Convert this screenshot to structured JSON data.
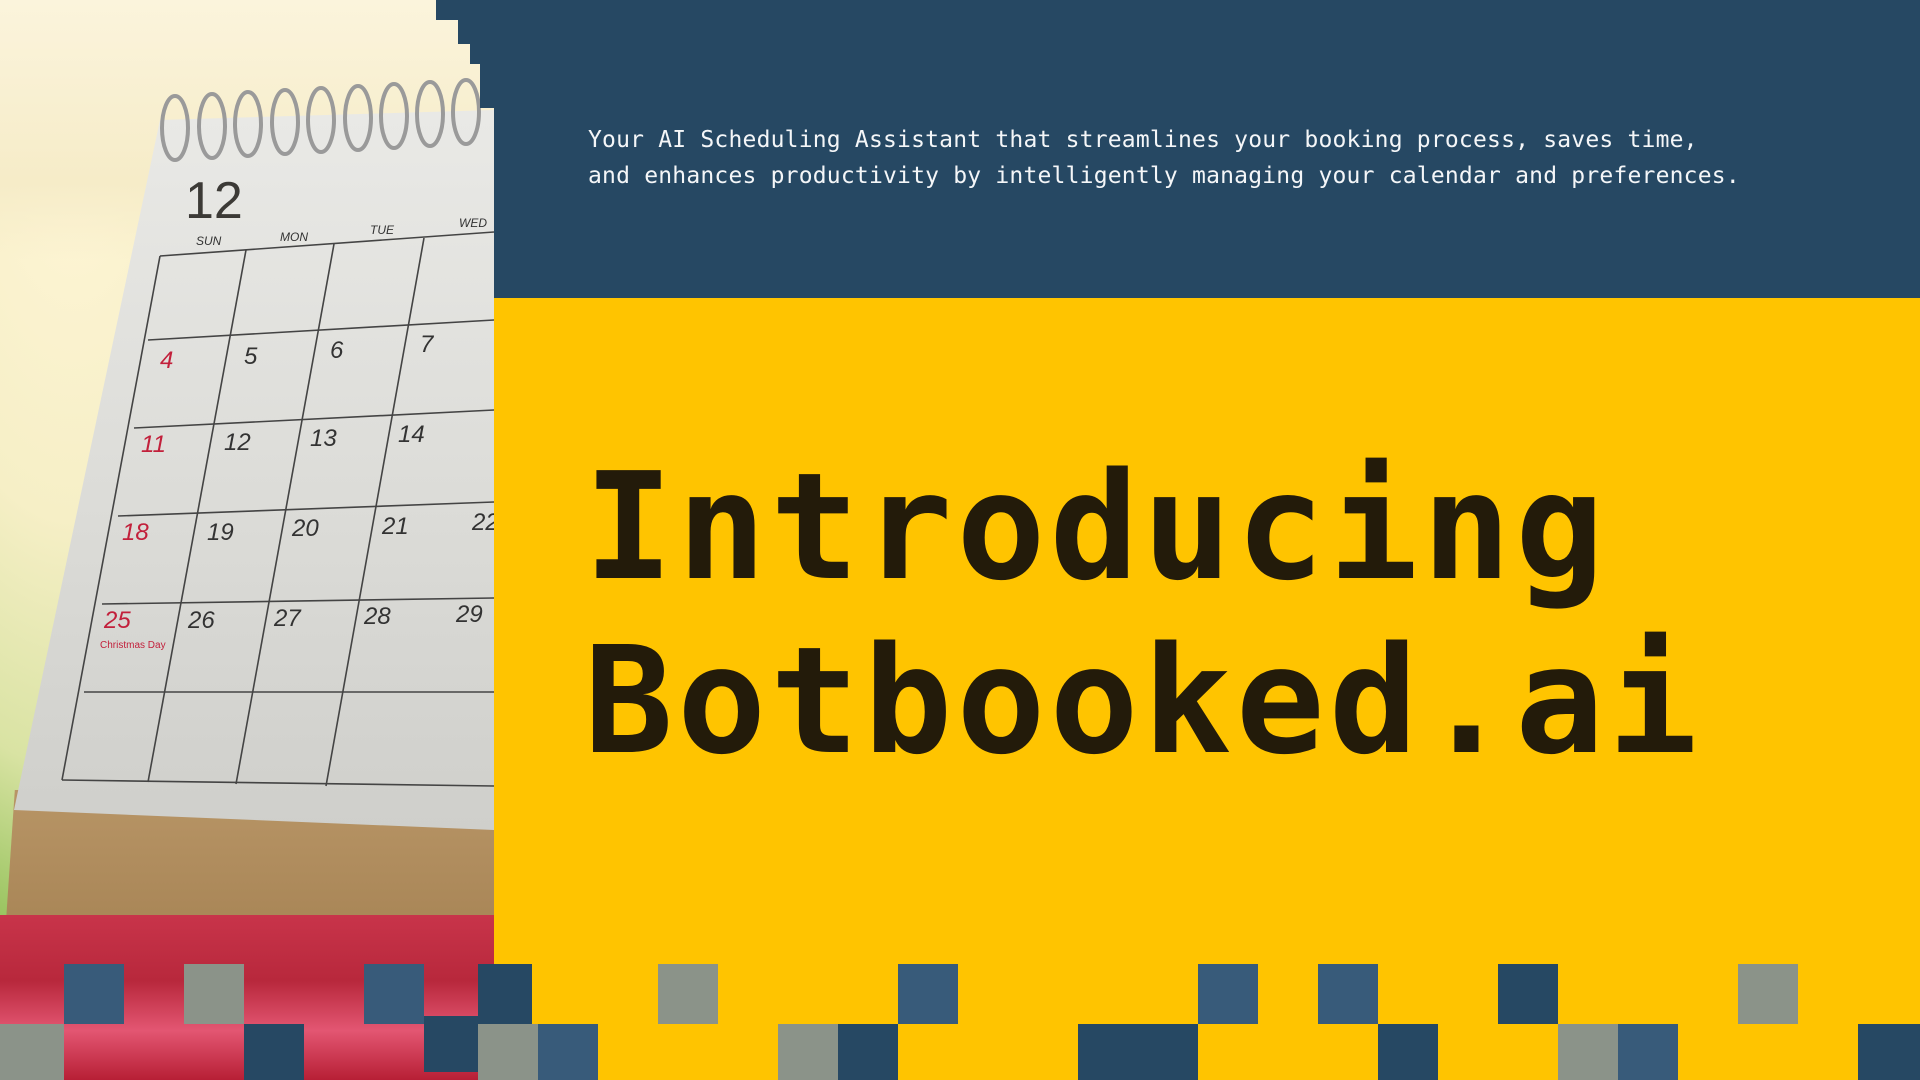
{
  "tagline": "Your AI Scheduling Assistant that streamlines your booking process, saves time, and enhances productivity by intelligently managing your calendar and preferences.",
  "headline": {
    "line1": "Introducing",
    "line2": "Botbooked.ai"
  },
  "photo": {
    "alt": "Desk calendar",
    "calendar": {
      "month": "12",
      "days": [
        "SUN",
        "MON",
        "TUE",
        "WED"
      ],
      "weeks": [
        [
          "4",
          "5",
          "6",
          "7"
        ],
        [
          "11",
          "12",
          "13",
          "14"
        ],
        [
          "18",
          "19",
          "20",
          "21",
          "22"
        ],
        [
          "25",
          "26",
          "27",
          "28",
          "29"
        ]
      ],
      "holiday": "Christmas Day"
    }
  },
  "colors": {
    "background": "#FFC400",
    "navy": "#264863",
    "blue": "#385b7a",
    "gray": "#8b9389",
    "headline": "#231b0a",
    "tagline": "#f4f6f8"
  }
}
